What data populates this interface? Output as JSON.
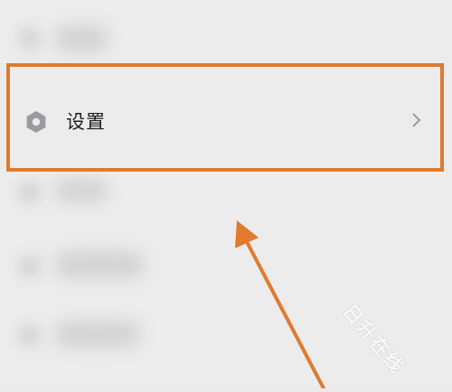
{
  "settings_row": {
    "label": "设置",
    "icon": "gear-hexagon-icon",
    "chevron": "chevron-right-icon"
  },
  "annotation": {
    "highlight_color": "#e07a2e",
    "arrow_color": "#e07a2e"
  },
  "watermark": {
    "text": "日升在线"
  }
}
